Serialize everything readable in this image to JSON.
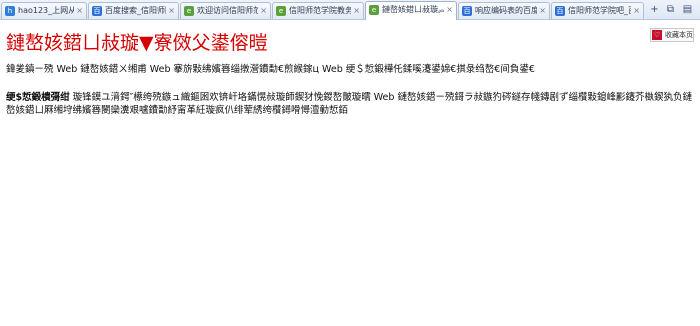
{
  "tabs": [
    {
      "label": "hao123_上网从这里…",
      "fav": "h",
      "color": "#2f7fd8"
    },
    {
      "label": "百度搜索_信阳师院",
      "fav": "百",
      "color": "#2f6fd8"
    },
    {
      "label": "欢迎访问信阳师范学…",
      "fav": "e",
      "color": "#5aa13d"
    },
    {
      "label": "信阳师范学院教务处",
      "fav": "e",
      "color": "#5aa13d"
    },
    {
      "label": "鏈嶅姟鍣ㄩ敊璇︽",
      "fav": "e",
      "color": "#5aa13d"
    },
    {
      "label": "响应编码表的百度…",
      "fav": "百",
      "color": "#2f6fd8"
    },
    {
      "label": "信阳师范学院吧_百…",
      "fav": "百",
      "color": "#2f6fd8"
    }
  ],
  "tab_controls": [
    "+",
    "⧉",
    "▤"
  ],
  "tab_close": "×",
  "page": {
    "title": "鏈嶅姟鍣ㄩ敊璇▼寮傚父鍙傛暟",
    "paragraph1": "鍏夎鎮ㄧ殑 Web 鏈嶅姟鍣ㄨ缃甫 Web 搴旂敤绋嬪簭缁撴瀯鐨勫€煎緱鎵ц Web 绠＄悊鍛樺仛鍒嗘瀽鍙婂€掑彔绉嶅€间負鍙€",
    "para2_label": "绠$悊鍛樻彁绀",
    "paragraph2": "璇锋鏌ユ湇鍔″櫒绔殑鏃ュ織鏂囦欢锛屽垎鏋愰敊璇師鍥犲悗鍐嶅皾璇曘 Web 鏈嶅姟鍣ㄧ殑鎶ラ敊鏃犳硶鐩存帴鏄剧ず缁欑敤鎴峰彲鑳芥槸鍥犱负鏈嶅姟鍣ㄩ厤缃垨绋嬪簭閿欒瀵艰嚧鐨勫紓甯革紝璇疯仈绯荤綉绔欑鐞嗗憳澶勭悊銆"
  },
  "bookmark": {
    "icon": "♡",
    "label": "收藏本页"
  }
}
